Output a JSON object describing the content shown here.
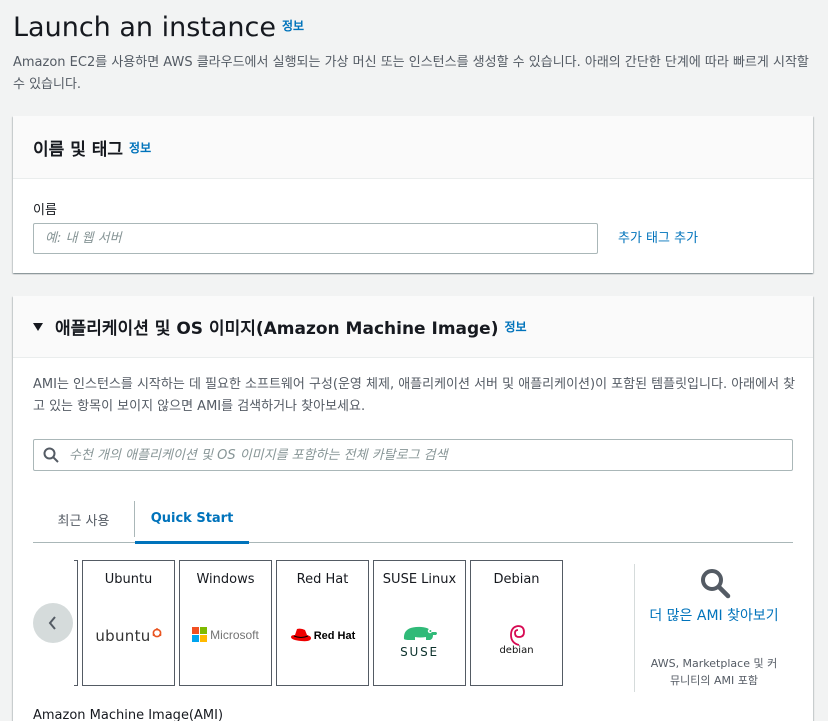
{
  "page": {
    "title": "Launch an instance",
    "info": "정보",
    "description": "Amazon EC2를 사용하면 AWS 클라우드에서 실행되는 가상 머신 또는 인스턴스를 생성할 수 있습니다. 아래의 간단한 단계에 따라 빠르게 시작할 수 있습니다."
  },
  "name_section": {
    "title": "이름 및 태그",
    "info": "정보",
    "field_label": "이름",
    "placeholder": "예: 내 웹 서버",
    "value": "",
    "add_tag": "추가 태그 추가"
  },
  "ami_section": {
    "title": "애플리케이션 및 OS 이미지(Amazon Machine Image)",
    "info": "정보",
    "description": "AMI는 인스턴스를 시작하는 데 필요한 소프트웨어 구성(운영 체제, 애플리케이션 서버 및 애플리케이션)이 포함된 템플릿입니다. 아래에서 찾고 있는 항목이 보이지 않으면 AMI를 검색하거나 찾아보세요.",
    "search_placeholder": "수천 개의 애플리케이션 및 OS 이미지를 포함하는 전체 카탈로그 검색",
    "tabs": [
      {
        "label": "최근 사용",
        "active": false
      },
      {
        "label": "Quick Start",
        "active": true
      }
    ],
    "tiles": [
      {
        "name": "Ubuntu",
        "logo_text": "ubuntu",
        "icon": "ubuntu-logo",
        "color": "#e95420"
      },
      {
        "name": "Windows",
        "logo_text": "Microsoft",
        "icon": "microsoft-logo",
        "color": "#737373"
      },
      {
        "name": "Red Hat",
        "logo_text": "Red Hat",
        "icon": "redhat-logo",
        "color": "#ee0000"
      },
      {
        "name": "SUSE Linux",
        "logo_text": "SUSE",
        "icon": "suse-logo",
        "color": "#30ba78"
      },
      {
        "name": "Debian",
        "logo_text": "debian",
        "icon": "debian-logo",
        "color": "#d70a53"
      }
    ],
    "browse_more": "더 많은 AMI 찾아보기",
    "browse_more_sub": "AWS, Marketplace 및 커뮤니티의 AMI 포함",
    "ami_label": "Amazon Machine Image(AMI)"
  },
  "colors": {
    "link": "#0073bb",
    "text": "#16191f",
    "muted": "#545b64",
    "background": "#f2f3f3"
  }
}
